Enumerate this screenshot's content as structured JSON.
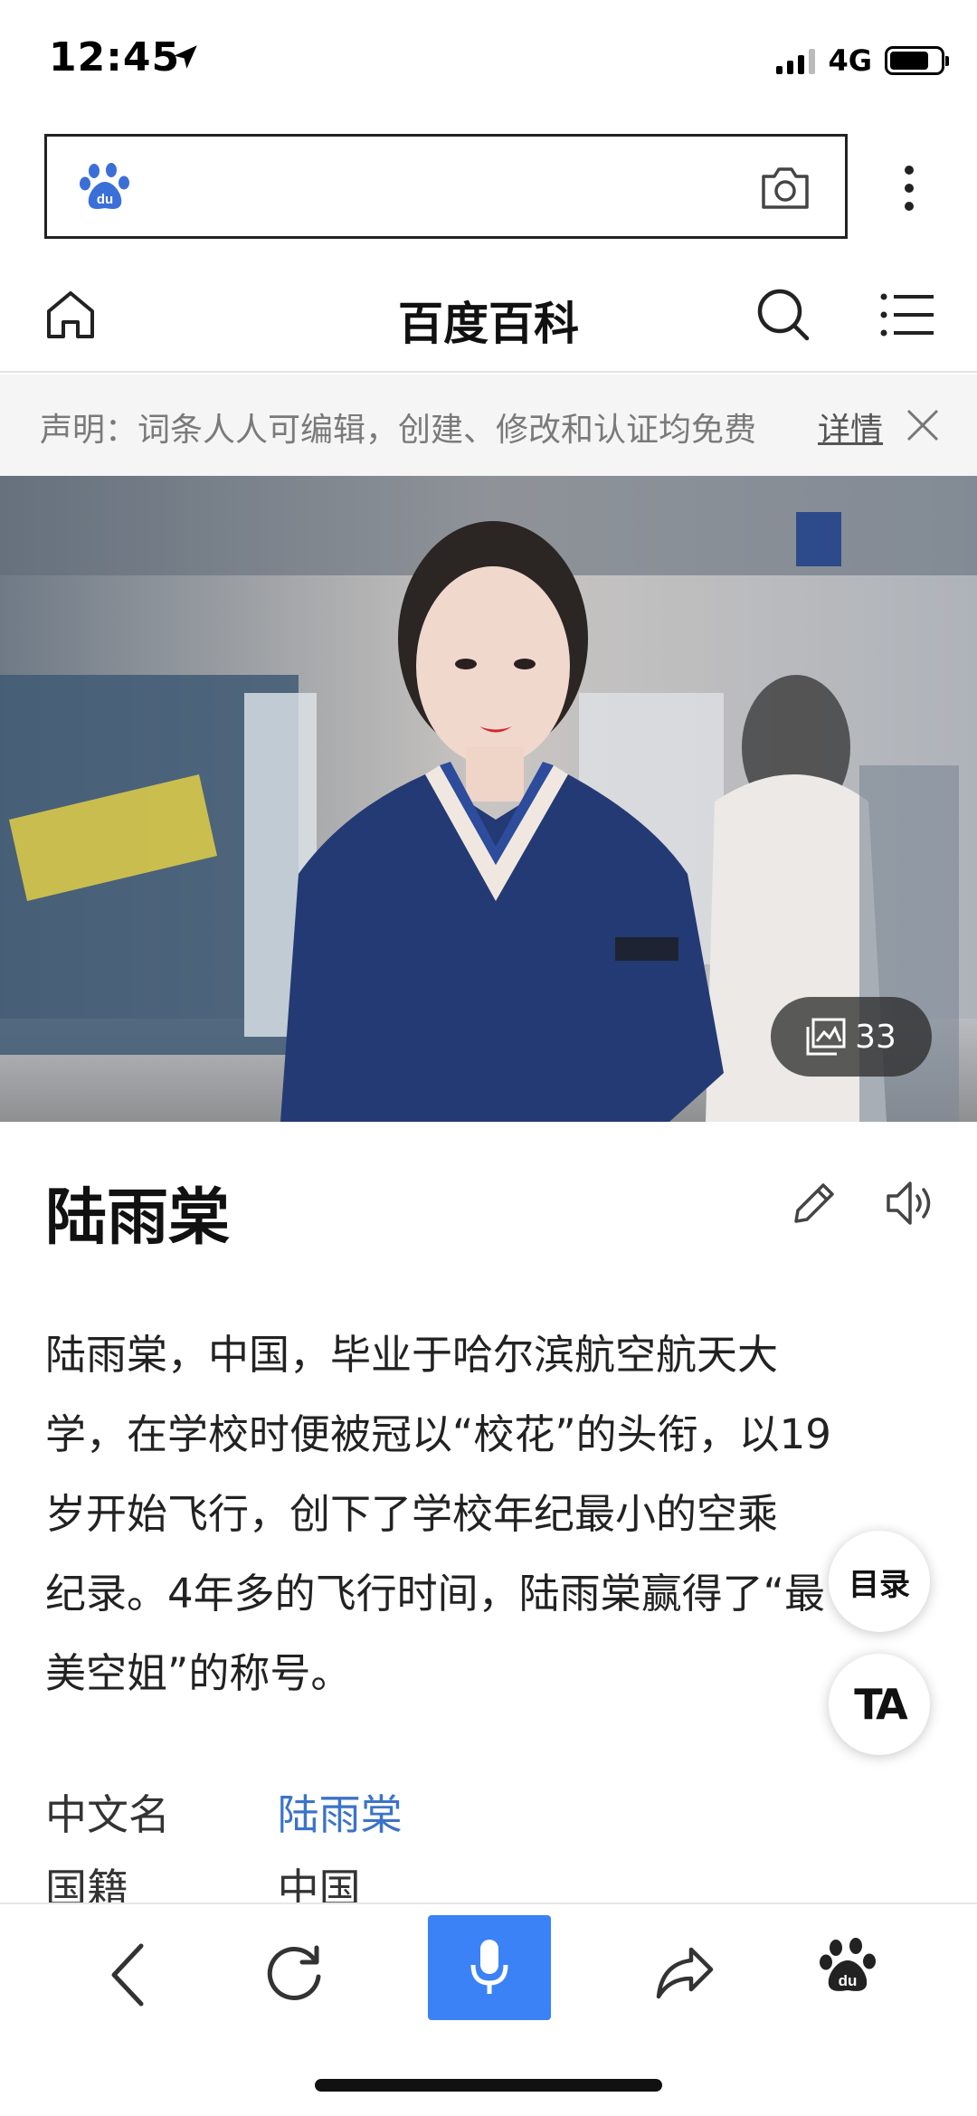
{
  "status_bar": {
    "time": "12:45",
    "network": "4G"
  },
  "search": {
    "placeholder": ""
  },
  "nav": {
    "title": "百度百科"
  },
  "notice": {
    "text": "声明：词条人人可编辑，创建、修改和认证均免费",
    "detail_link": "详情"
  },
  "hero": {
    "gallery_count": "33"
  },
  "entry": {
    "title": "陆雨棠",
    "summary_lines": [
      "陆雨棠，中国，毕业于哈尔滨航空航天大",
      "学，在学校时便被冠以“校花”的头衔，以19",
      "岁开始飞行，创下了学校年纪最小的空乘",
      "纪录。4年多的飞行时间，陆雨棠赢得了“最",
      "美空姐”的称号。"
    ]
  },
  "floating": {
    "toc_label": "目录",
    "font_label": "TA"
  },
  "info": [
    {
      "label": "中文名",
      "value": "陆雨棠"
    },
    {
      "label": "国籍",
      "value": "中国"
    }
  ],
  "colors": {
    "accent": "#3b82f6",
    "link": "#3b73c8",
    "notice_bg": "#f5f5f5"
  }
}
